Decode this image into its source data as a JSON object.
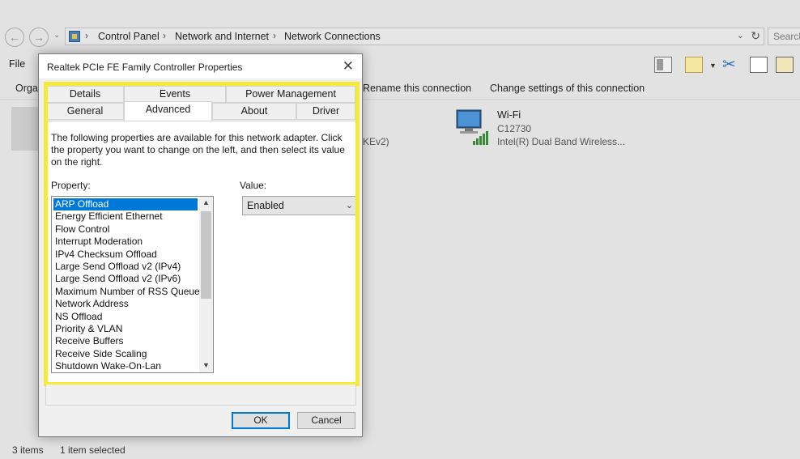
{
  "explorer": {
    "breadcrumbs": [
      "Control Panel",
      "Network and Internet",
      "Network Connections"
    ],
    "search_placeholder": "Search",
    "menu_file": "File",
    "commands": [
      "Organize",
      "Rename this connection",
      "Change settings of this connection"
    ],
    "wifi": {
      "name": "Wi-Fi",
      "ssid": "C12730",
      "adapter": "Intel(R) Dual Band Wireless..."
    },
    "partial_adapter_text": "KEv2)",
    "status_items_count": "3 items",
    "status_selected": "1 item selected"
  },
  "dialog": {
    "title": "Realtek PCIe FE Family Controller Properties",
    "tabs_row1": [
      "Details",
      "Events",
      "Power Management"
    ],
    "tabs_row2": [
      "General",
      "Advanced",
      "About",
      "Driver"
    ],
    "active_tab": "Advanced",
    "description": "The following properties are available for this network adapter. Click the property you want to change on the left, and then select its value on the right.",
    "property_label": "Property:",
    "value_label": "Value:",
    "properties": [
      "ARP Offload",
      "Energy Efficient Ethernet",
      "Flow Control",
      "Interrupt Moderation",
      "IPv4 Checksum Offload",
      "Large Send Offload v2 (IPv4)",
      "Large Send Offload v2 (IPv6)",
      "Maximum Number of RSS Queues",
      "Network Address",
      "NS Offload",
      "Priority & VLAN",
      "Receive Buffers",
      "Receive Side Scaling",
      "Shutdown Wake-On-Lan"
    ],
    "selected_property": "ARP Offload",
    "value": "Enabled",
    "ok_label": "OK",
    "cancel_label": "Cancel",
    "highlight_color": "#f5e93a",
    "accent_color": "#0078d7"
  }
}
